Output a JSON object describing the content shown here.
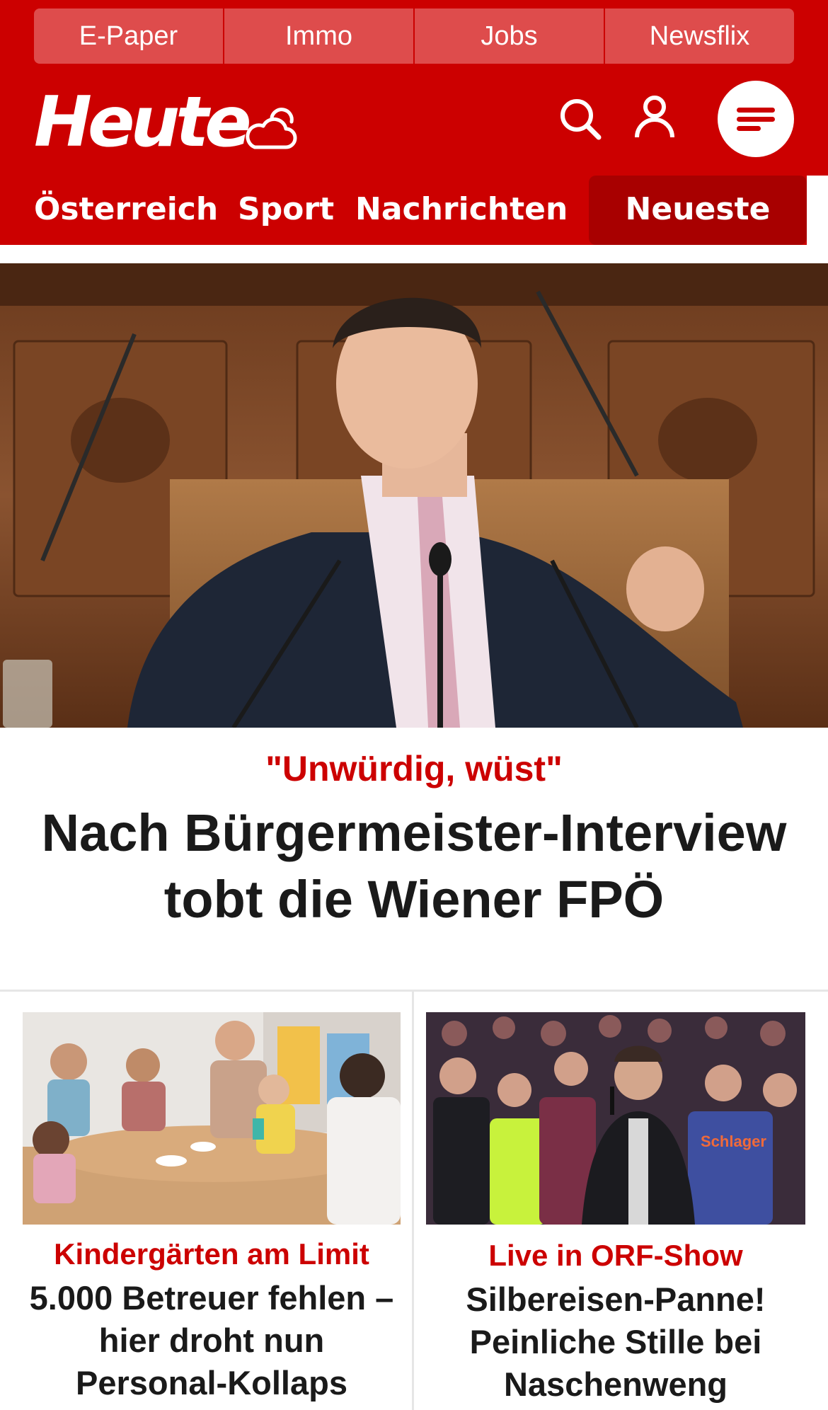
{
  "top_links": [
    "E-Paper",
    "Immo",
    "Jobs",
    "Newsflix"
  ],
  "logo_text": "Heute",
  "nav": {
    "items": [
      "Österreich",
      "Sport",
      "Nachrichten"
    ],
    "active": "Neueste"
  },
  "hero": {
    "kicker": "\"Unwürdig, wüst\"",
    "title": "Nach Bürgermeister-Interview tobt die Wiener FPÖ"
  },
  "teasers": [
    {
      "kicker": "Kindergärten am Limit",
      "title": "5.000 Betreuer fehlen – hier droht nun Personal-Kollaps"
    },
    {
      "kicker": "Live in ORF-Show",
      "title": "Silbereisen-Panne! Peinliche Stille bei Naschenweng",
      "photo_sign": "Schlager"
    }
  ],
  "colors": {
    "brand": "#cc0000",
    "top_link_bg": "#de4c4c",
    "active_tab": "#a80000"
  }
}
